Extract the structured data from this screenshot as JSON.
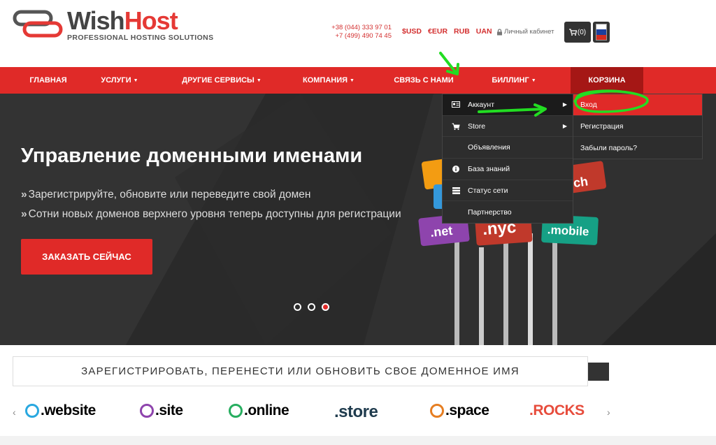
{
  "header": {
    "logo": {
      "name_part1": "Wish",
      "name_part2": "Host",
      "tagline": "PROFESSIONAL HOSTING SOLUTIONS"
    },
    "phones": [
      "+38 (044) 333 97 01",
      "+7 (499) 490 74 45"
    ],
    "currencies": [
      "$USD",
      "€EUR",
      "RUB",
      "UAN"
    ],
    "cabinet_label": "Личный кабинет",
    "cart_label": "(0)",
    "flag_colors": [
      "#ffffff",
      "#1c3f9e",
      "#d52b1e"
    ]
  },
  "nav": {
    "items": [
      {
        "label": "ГЛАВНАЯ",
        "caret": false
      },
      {
        "label": "УСЛУГИ",
        "caret": true
      },
      {
        "label": "ДРУГИЕ СЕРВИСЫ",
        "caret": true
      },
      {
        "label": "КОМПАНИЯ",
        "caret": true
      },
      {
        "label": "СВЯЗЬ С НАМИ",
        "caret": false
      },
      {
        "label": "БИЛЛИНГ",
        "caret": true
      },
      {
        "label": "КОРЗИНА",
        "caret": false
      }
    ]
  },
  "billing_menu": {
    "items": [
      {
        "label": "Аккаунт",
        "icon": "id-card-icon",
        "has_submenu": true
      },
      {
        "label": "Store",
        "icon": "cart-icon",
        "has_submenu": true
      },
      {
        "label": "Объявления",
        "icon": "",
        "has_submenu": false
      },
      {
        "label": "База знаний",
        "icon": "info-icon",
        "has_submenu": false
      },
      {
        "label": "Статус сети",
        "icon": "server-icon",
        "has_submenu": false
      },
      {
        "label": "Партнерство",
        "icon": "",
        "has_submenu": false
      }
    ],
    "submenu": [
      "Вход",
      "Регистрация",
      "Забыли пароль?"
    ]
  },
  "hero": {
    "title": "Управление доменными именами",
    "lines": [
      "Зарегистрируйте, обновите или переведите свой домен",
      "Сотни новых доменов верхнего уровня теперь доступны для регистрации"
    ],
    "cta": "ЗАКАЗАТЬ СЕЙЧАС",
    "slide_count": 3,
    "active_slide": 3,
    "signs": [
      ".net",
      ".nyc",
      ".mobile",
      "rch"
    ]
  },
  "domain_bar": {
    "title": "ЗАРЕГИСТРИРОВАТЬ, ПЕРЕНЕСТИ ИЛИ ОБНОВИТЬ СВОЕ ДОМЕННОЕ ИМЯ"
  },
  "tlds": [
    {
      "label": ".website",
      "color": "#1a1a1a",
      "icon_color": "#29a8e0"
    },
    {
      "label": ".site",
      "color": "#1a1a1a",
      "icon_color": "#8e44ad"
    },
    {
      "label": ".online",
      "color": "#1a1a1a",
      "icon_color": "#27ae60"
    },
    {
      "label": ".store",
      "color": "#1a1a1a",
      "icon_color": ""
    },
    {
      "label": ".space",
      "color": "#1a1a1a",
      "icon_color": "#e67e22"
    },
    {
      "label": ".ROCKS",
      "color": "#e74c3c",
      "icon_color": ""
    }
  ],
  "colors": {
    "brand_red": "#e02a28",
    "nav_dark": "#a51715",
    "menu_bg": "#2d2d2d",
    "annotation_green": "#22dd22"
  }
}
